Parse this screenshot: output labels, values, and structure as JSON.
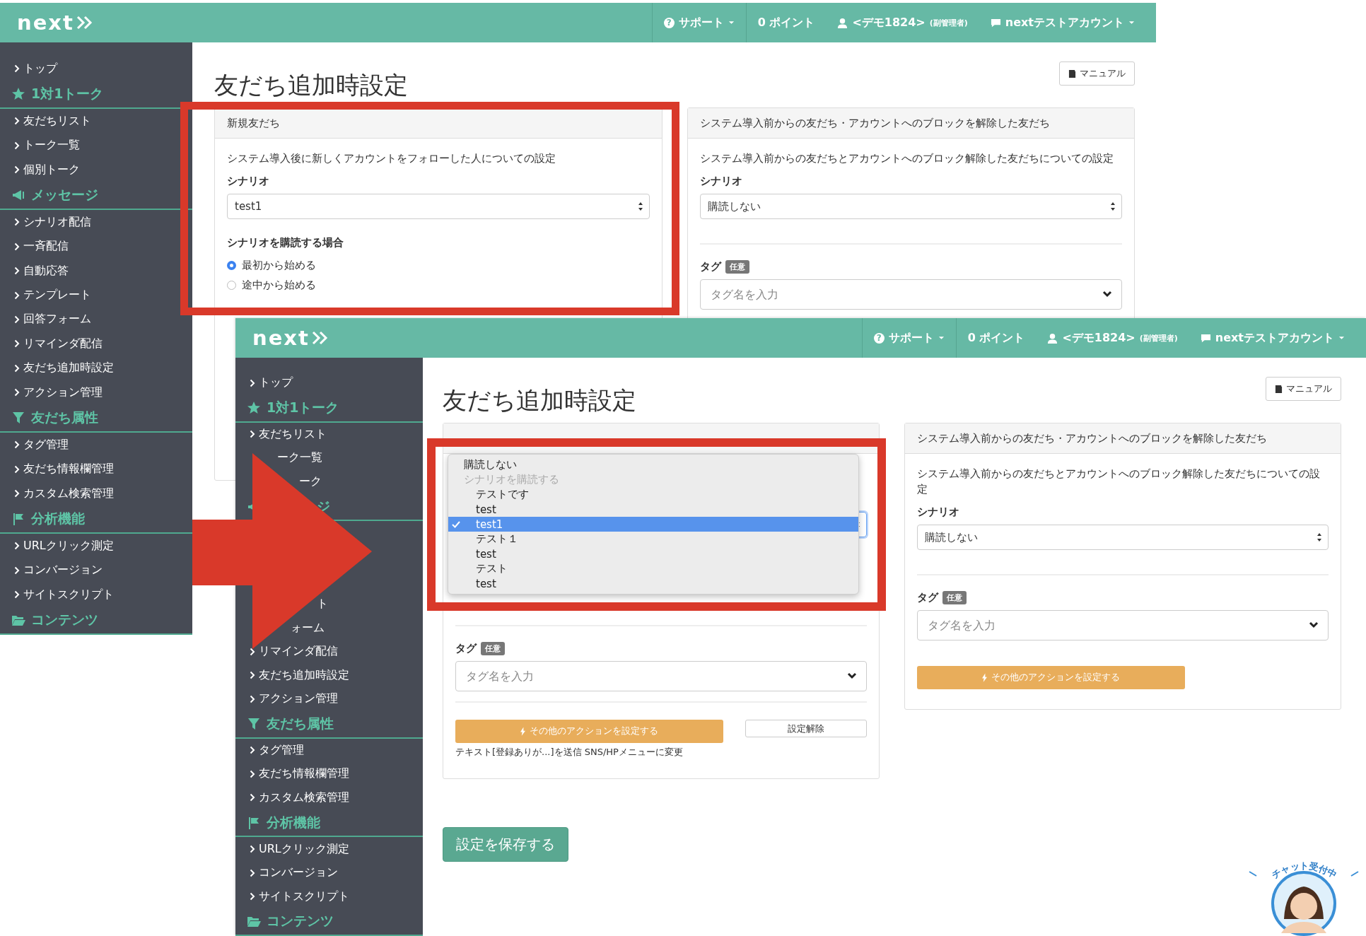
{
  "screenshots": [
    {
      "header": {
        "logo": "next",
        "help_icon": "?",
        "support": "サポート",
        "points": "0 ポイント",
        "user": "<デモ1824>",
        "role": "(副管理者)",
        "account": "nextテストアカウント"
      },
      "sidebar": [
        {
          "kind": "link",
          "label": "トップ"
        },
        {
          "kind": "section",
          "label": "1対1トーク"
        },
        {
          "kind": "link",
          "label": "友だちリスト"
        },
        {
          "kind": "link",
          "label": "トーク一覧"
        },
        {
          "kind": "link",
          "label": "個別トーク"
        },
        {
          "kind": "section",
          "label": "メッセージ"
        },
        {
          "kind": "link",
          "label": "シナリオ配信"
        },
        {
          "kind": "link",
          "label": "一斉配信"
        },
        {
          "kind": "link",
          "label": "自動応答"
        },
        {
          "kind": "link",
          "label": "テンプレート"
        },
        {
          "kind": "link",
          "label": "回答フォーム"
        },
        {
          "kind": "link",
          "label": "リマインダ配信"
        },
        {
          "kind": "link",
          "label": "友だち追加時設定"
        },
        {
          "kind": "link",
          "label": "アクション管理"
        },
        {
          "kind": "section",
          "label": "友だち属性"
        },
        {
          "kind": "link",
          "label": "タグ管理"
        },
        {
          "kind": "link",
          "label": "友だち情報欄管理"
        },
        {
          "kind": "link",
          "label": "カスタム検索管理"
        },
        {
          "kind": "section",
          "label": "分析機能"
        },
        {
          "kind": "link",
          "label": "URLクリック測定"
        },
        {
          "kind": "link",
          "label": "コンバージョン"
        },
        {
          "kind": "link",
          "label": "サイトスクリプト"
        },
        {
          "kind": "section",
          "label": "コンテンツ"
        }
      ],
      "page_title": "友だち追加時設定",
      "manual_button": "マニュアル",
      "panels": [
        {
          "title": "新規友だち",
          "items": [
            {
              "kind": "text",
              "text": "システム導入後に新しくアカウントをフォローした人についての設定"
            },
            {
              "kind": "label",
              "text": "シナリオ"
            },
            {
              "kind": "select",
              "value": "test1",
              "focused": false
            },
            {
              "kind": "label",
              "text": "シナリオを購読する場合"
            },
            {
              "kind": "radio",
              "label": "最初から始める",
              "selected": true
            },
            {
              "kind": "radio",
              "label": "途中から始める",
              "selected": false
            }
          ]
        },
        {
          "title": "システム導入前からの友だち・アカウントへのブロックを解除した友だち",
          "items": [
            {
              "kind": "text",
              "text": "システム導入前からの友だちとアカウントへのブロック解除した友だちについての設定"
            },
            {
              "kind": "label",
              "text": "シナリオ"
            },
            {
              "kind": "select",
              "value": "購読しない",
              "focused": false
            },
            {
              "kind": "divider"
            },
            {
              "kind": "tag",
              "text": "タグ",
              "badge": "任意"
            },
            {
              "kind": "tag_input",
              "placeholder": "タグ名を入力"
            }
          ]
        }
      ]
    },
    {
      "header": {
        "logo": "next",
        "help_icon": "?",
        "support": "サポート",
        "points": "0 ポイント",
        "user": "<デモ1824>",
        "role": "(副管理者)",
        "account": "nextテストアカウント"
      },
      "sidebar": [
        {
          "kind": "link",
          "label": "トップ"
        },
        {
          "kind": "section",
          "label": "1対1トーク"
        },
        {
          "kind": "link",
          "label": "友だちリスト"
        },
        {
          "kind": "partial",
          "label": "ーク一覧"
        },
        {
          "kind": "partial",
          "label": "ーク"
        },
        {
          "kind": "partial_section",
          "label": "ジ"
        },
        {
          "kind": "covered"
        },
        {
          "kind": "covered"
        },
        {
          "kind": "covered"
        },
        {
          "kind": "partial",
          "label": "ト"
        },
        {
          "kind": "partial",
          "label": "ォーム"
        },
        {
          "kind": "link",
          "label": "リマインダ配信"
        },
        {
          "kind": "link",
          "label": "友だち追加時設定"
        },
        {
          "kind": "link",
          "label": "アクション管理"
        },
        {
          "kind": "section",
          "label": "友だち属性"
        },
        {
          "kind": "link",
          "label": "タグ管理"
        },
        {
          "kind": "link",
          "label": "友だち情報欄管理"
        },
        {
          "kind": "link",
          "label": "カスタム検索管理"
        },
        {
          "kind": "section",
          "label": "分析機能"
        },
        {
          "kind": "link",
          "label": "URLクリック測定"
        },
        {
          "kind": "link",
          "label": "コンバージョン"
        },
        {
          "kind": "link",
          "label": "サイトスクリプト"
        },
        {
          "kind": "section",
          "label": "コンテンツ"
        }
      ],
      "page_title": "友だち追加時設定",
      "manual_button": "マニュアル",
      "panels": [
        {
          "items": [
            {
              "kind": "select",
              "focused": true,
              "options": [
                {
                  "kind": "option",
                  "label": "購読しない",
                  "selected": false
                },
                {
                  "kind": "group",
                  "label": "シナリオを購読する"
                },
                {
                  "kind": "suboption",
                  "label": "テストです",
                  "selected": false
                },
                {
                  "kind": "suboption",
                  "label": "test",
                  "selected": false
                },
                {
                  "kind": "suboption",
                  "label": "test1",
                  "selected": true
                },
                {
                  "kind": "suboption",
                  "label": "テスト１",
                  "selected": false
                },
                {
                  "kind": "suboption",
                  "label": "test",
                  "selected": false
                },
                {
                  "kind": "suboption",
                  "label": "テスト",
                  "selected": false
                },
                {
                  "kind": "suboption",
                  "label": "test",
                  "selected": false
                }
              ]
            },
            {
              "kind": "divider"
            },
            {
              "kind": "tag",
              "text": "タグ",
              "badge": "任意"
            },
            {
              "kind": "tag_input",
              "placeholder": "タグ名を入力"
            },
            {
              "kind": "divider"
            },
            {
              "kind": "actions",
              "button": "その他のアクションを設定する",
              "clear_button": "設定解除"
            },
            {
              "kind": "note",
              "text": "テキスト[登録ありが...]を送信 SNS/HPメニューに変更"
            }
          ]
        },
        {
          "title": "システム導入前からの友だち・アカウントへのブロックを解除した友だち",
          "items": [
            {
              "kind": "text",
              "text": "システム導入前からの友だちとアカウントへのブロック解除した友だちについての設定"
            },
            {
              "kind": "label",
              "text": "シナリオ"
            },
            {
              "kind": "select",
              "value": "購読しない",
              "focused": false
            },
            {
              "kind": "divider"
            },
            {
              "kind": "tag",
              "text": "タグ",
              "badge": "任意"
            },
            {
              "kind": "tag_input",
              "placeholder": "タグ名を入力"
            },
            {
              "kind": "actions",
              "button": "その他のアクションを設定する"
            }
          ]
        }
      ],
      "save_button": "設定を保存する"
    }
  ],
  "chat_badge": {
    "label": "チャット受付中"
  }
}
